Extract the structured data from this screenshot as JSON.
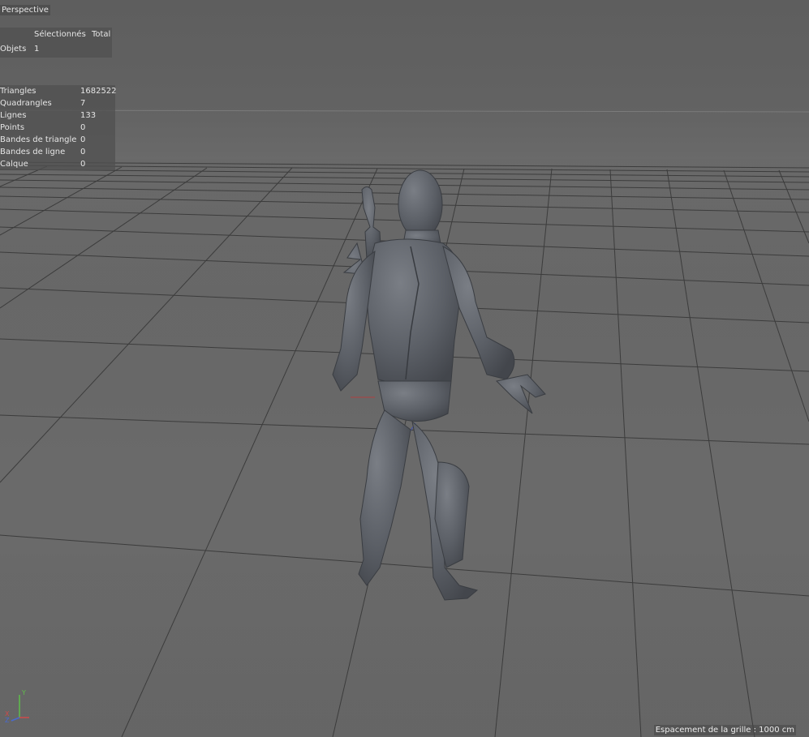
{
  "viewport": {
    "camera_label": "Perspective",
    "grid_spacing_text": "Espacement de la grille : 1000 cm"
  },
  "selection_hud": {
    "col_selected": "Sélectionnés",
    "col_total": "Total",
    "objects_label": "Objets",
    "objects_value": "1"
  },
  "stats_hud": {
    "rows": [
      {
        "label": "Triangles",
        "value": "1682522"
      },
      {
        "label": "Quadrangles",
        "value": "7"
      },
      {
        "label": "Lignes",
        "value": "133"
      },
      {
        "label": "Points",
        "value": "0"
      },
      {
        "label": "Bandes de triangle",
        "value": "0"
      },
      {
        "label": "Bandes de ligne",
        "value": "0"
      },
      {
        "label": "Calque",
        "value": "0"
      }
    ]
  },
  "axis_gizmo": {
    "y_label": "Y",
    "x_label": "X",
    "z_label": "Z"
  },
  "colors": {
    "viewport_bg": "#666666",
    "grid_line": "#3c3c3c",
    "model": "#5d6066",
    "hud_text": "#e6e6e6"
  }
}
